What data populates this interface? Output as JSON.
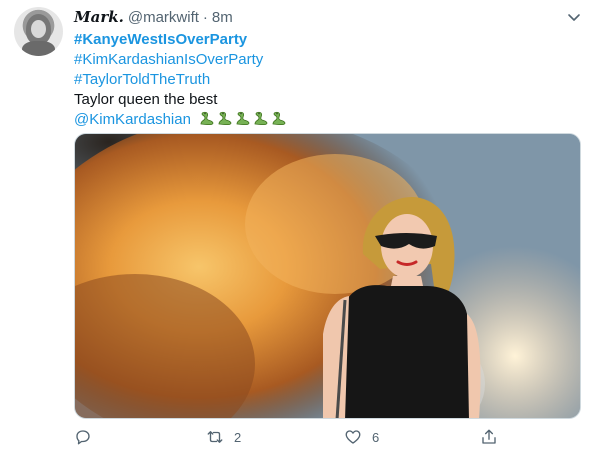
{
  "tweet": {
    "display_name": "Mark.",
    "handle": "@markwift",
    "separator": "·",
    "time": "8m",
    "lines": [
      {
        "text": "#KanyeWestIsOverParty",
        "kind": "hashtag-bold"
      },
      {
        "text": "#KimKardashianIsOverParty",
        "kind": "hashtag"
      },
      {
        "text": "#TaylorToldTheTruth",
        "kind": "hashtag"
      },
      {
        "text": "Taylor queen the best",
        "kind": "text"
      },
      {
        "text": "@KimKardashian",
        "kind": "mention"
      }
    ],
    "emoji": "snake-emoji",
    "emoji_count": 5,
    "media_icon": "photo-of-woman-walking-with-explosion-behind",
    "stats": {
      "reply": "",
      "retweet": "2",
      "like": "6",
      "share": ""
    },
    "colors": {
      "link": "#1b95e0",
      "muted": "#536471",
      "text": "#0f1419"
    }
  }
}
